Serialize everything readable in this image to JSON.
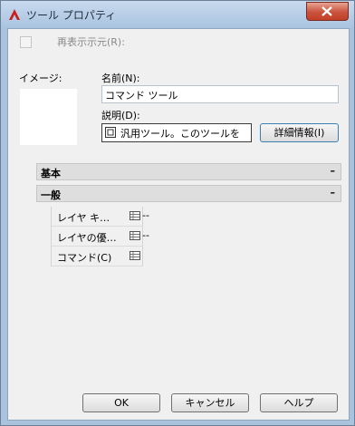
{
  "window": {
    "title": "ツール プロパティ"
  },
  "refresh_checkbox": {
    "label": "再表示示元(R):",
    "checked": false,
    "enabled": false
  },
  "image": {
    "label": "イメージ:"
  },
  "name": {
    "label": "名前(N):",
    "value": "コマンド ツール"
  },
  "description": {
    "label": "説明(D):",
    "value": "汎用ツール。このツールを"
  },
  "buttons": {
    "details": "詳細情報(I)",
    "ok": "OK",
    "cancel": "キャンセル",
    "help": "ヘルプ"
  },
  "sections": [
    {
      "title": "基本",
      "toggle": "–"
    },
    {
      "title": "一般",
      "toggle": "–"
    }
  ],
  "properties": [
    {
      "name": "レイヤ キ…",
      "value": "--"
    },
    {
      "name": "レイヤの優…",
      "value": "--"
    },
    {
      "name": "コマンド(C)",
      "value": ""
    }
  ]
}
